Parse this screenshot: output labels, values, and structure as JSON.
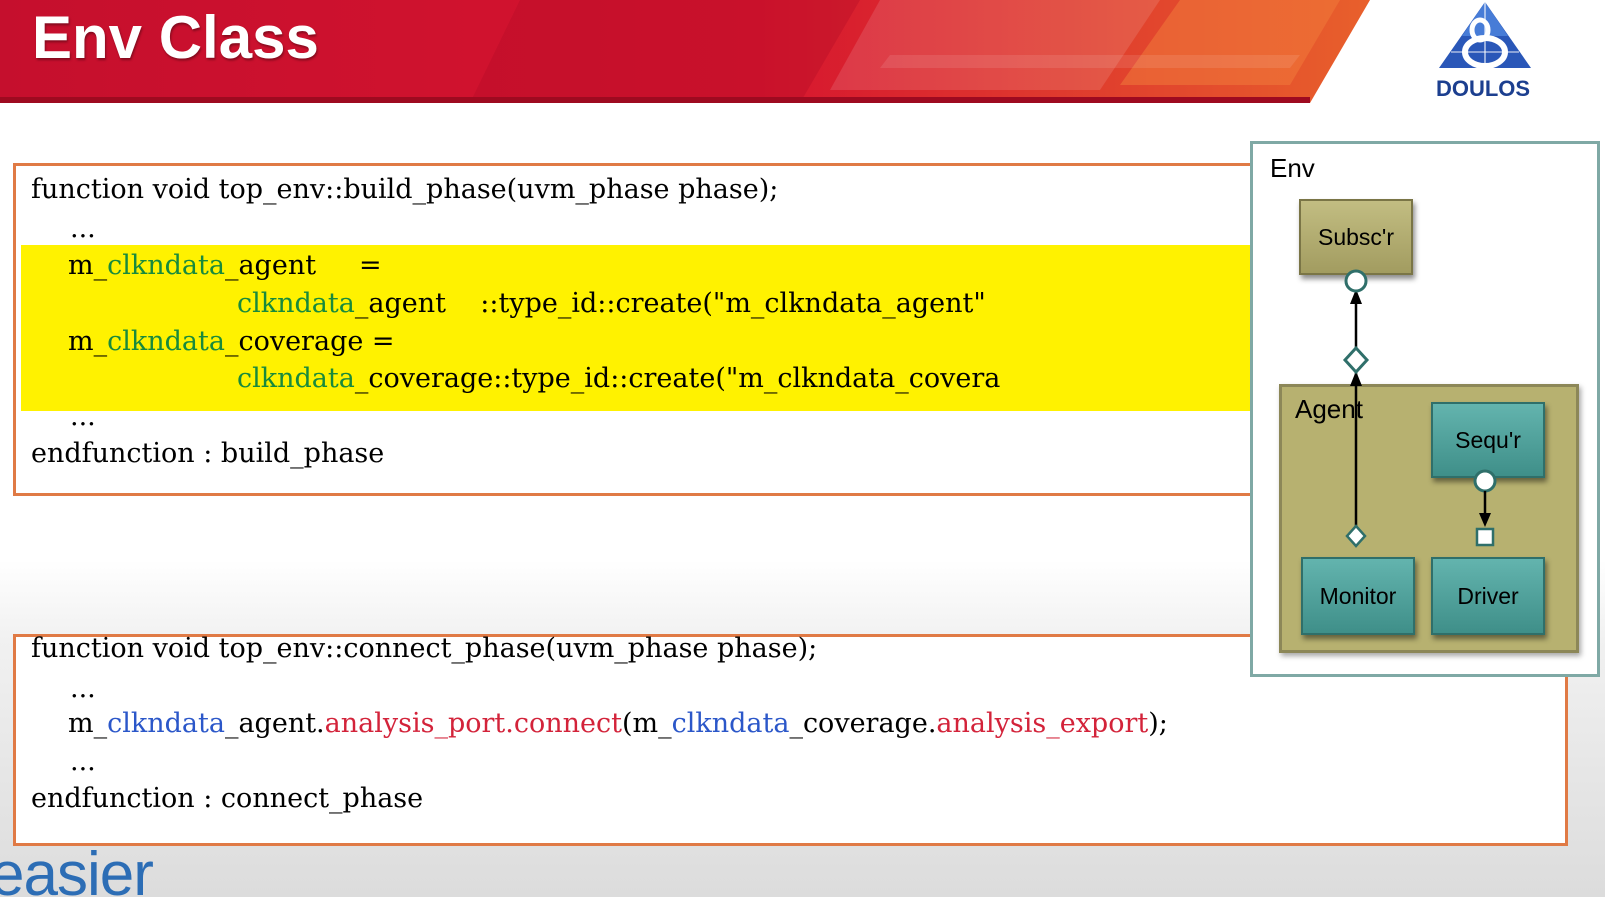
{
  "slide": {
    "title": "Env Class",
    "logo_text": "DOULOS",
    "footer_logo_text": "easier",
    "colors": {
      "banner_red": "#c8102e",
      "banner_orange": "#e8602c",
      "highlight_yellow": "#fff200",
      "box_border": "#e07a45",
      "keyword_green": "#188a3c",
      "keyword_blue": "#2b57c9",
      "keyword_red": "#d3233a"
    }
  },
  "build_phase": {
    "signature": "function void top_env::build_phase(uvm_phase phase);",
    "ellipsis_1": "...",
    "agent_var_prefix": "m_",
    "agent_var_mid": "clkndata",
    "agent_var_suffix": "_agent",
    "agent_assign": "     =",
    "agent_type_mid": "clkndata",
    "agent_type_suffix": "_agent    ::type_id::create(\"m_clkndata_agent\"",
    "coverage_var_prefix": "m_",
    "coverage_var_mid": "clkndata",
    "coverage_var_suffix": "_coverage =",
    "coverage_type_mid": "clkndata",
    "coverage_type_suffix": "_coverage::type_id::create(\"m_clkndata_covera",
    "ellipsis_2": "...",
    "end": "endfunction : build_phase"
  },
  "connect_phase": {
    "signature": "function void top_env::connect_phase(uvm_phase phase);",
    "ellipsis_1": "...",
    "stmt_prefix": "m_",
    "stmt_var1": "clkndata",
    "stmt_agent": "_agent.",
    "stmt_port": "analysis_port.connect",
    "stmt_open": "(m_",
    "stmt_var2": "clkndata",
    "stmt_coverage": "_coverage.",
    "stmt_export": "analysis_export",
    "stmt_close": ");",
    "ellipsis_2": "...",
    "end": "endfunction : connect_phase"
  },
  "diagram": {
    "env_label": "Env",
    "agent_label": "Agent",
    "subscriber": "Subsc'r",
    "sequencer": "Sequ'r",
    "monitor": "Monitor",
    "driver": "Driver"
  }
}
